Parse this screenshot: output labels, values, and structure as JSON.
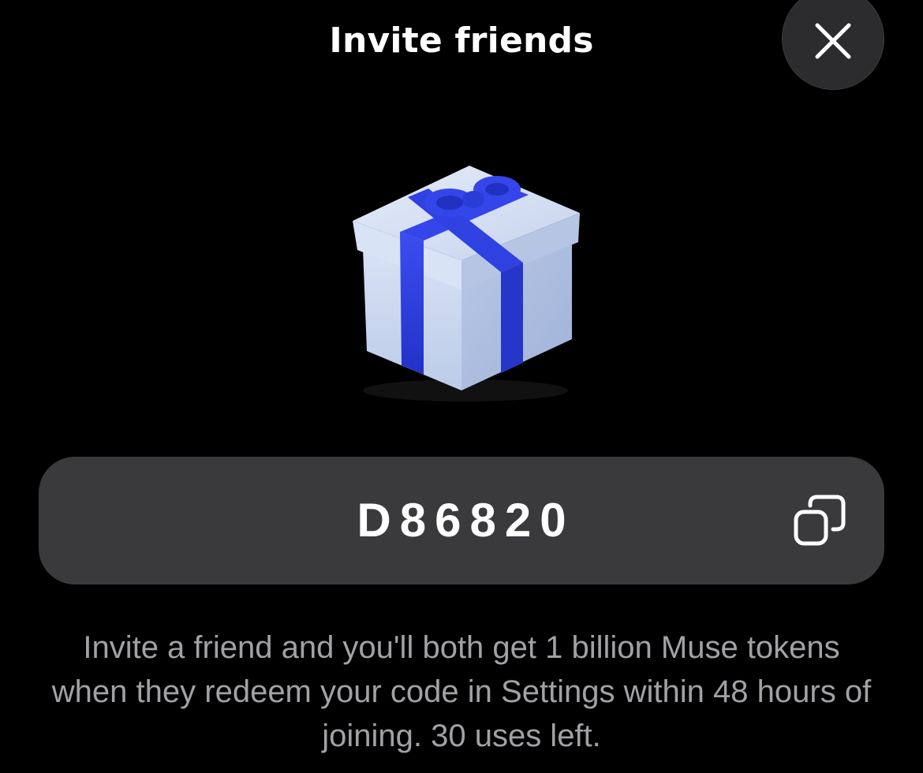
{
  "header": {
    "title": "Invite friends",
    "close_icon": "close-icon"
  },
  "hero": {
    "icon": "gift-icon",
    "box_color": "#c9d6ee",
    "ribbon_color": "#2d3fdc"
  },
  "code": {
    "value": "D86820",
    "copy_icon": "copy-icon"
  },
  "description": {
    "text": "Invite a friend and you'll both get 1 billion Muse tokens when they redeem your code in Settings within 48 hours of joining. 30 uses left."
  },
  "colors": {
    "background": "#000000",
    "pill": "#3a3a3c",
    "close_button": "#2c2c2e",
    "secondary_text": "#a1a1a6"
  }
}
